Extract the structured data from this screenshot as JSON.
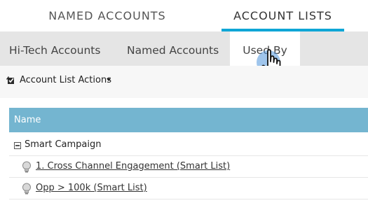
{
  "top_tabs": [
    {
      "label": "NAMED ACCOUNTS"
    },
    {
      "label": "ACCOUNT LISTS"
    }
  ],
  "sub_tabs": [
    {
      "label": "Hi-Tech Accounts"
    },
    {
      "label": "Named Accounts"
    },
    {
      "label": "Used By"
    }
  ],
  "toolbar": {
    "actions_label": "Account List Actions"
  },
  "grid": {
    "header": "Name",
    "group": "Smart Campaign",
    "items": [
      {
        "label": "1. Cross Channel Engagement (Smart List)"
      },
      {
        "label": "Opp > 100k (Smart List)"
      }
    ]
  },
  "colors": {
    "accent": "#0fa6d6",
    "grid_header": "#74b5d0",
    "tab_bar": "#e5e5e5"
  }
}
